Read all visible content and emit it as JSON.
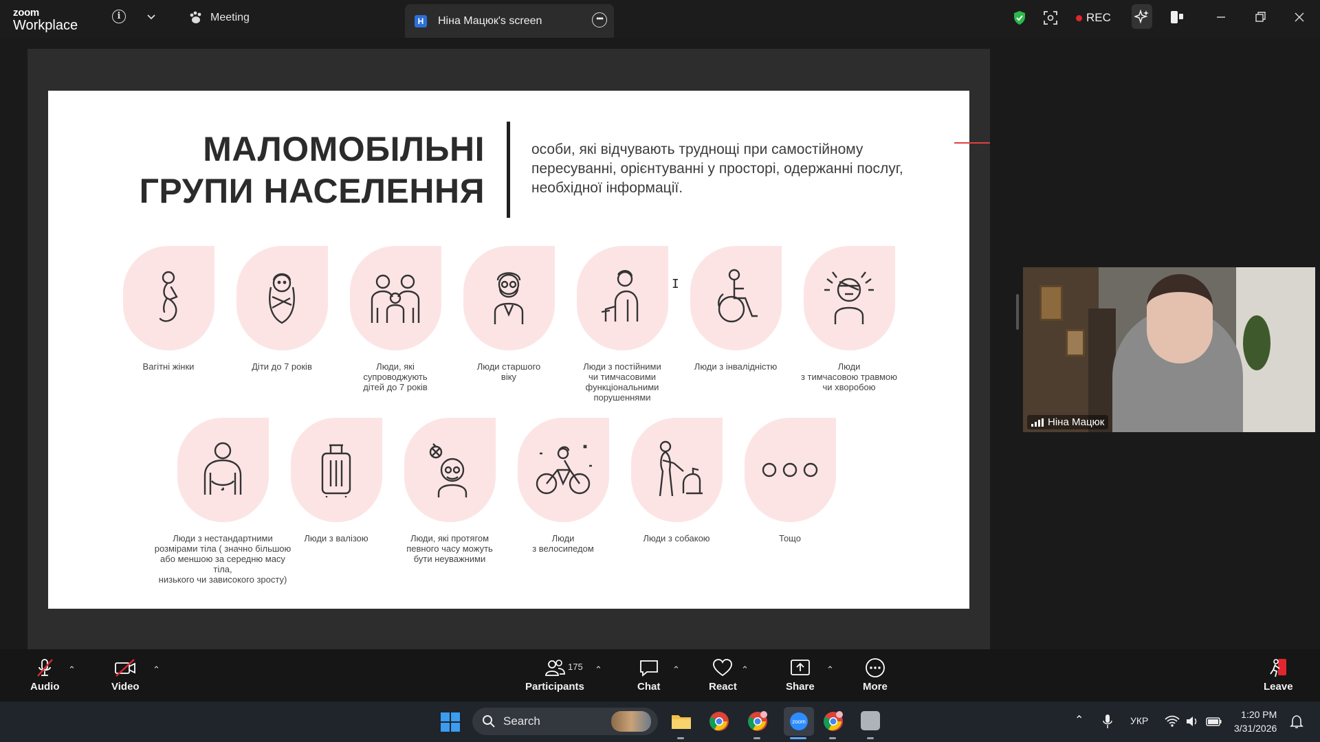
{
  "titlebar": {
    "brand_top": "zoom",
    "brand_bottom": "Workplace",
    "meeting_label": "Meeting",
    "tab_initial": "Н",
    "tab_title": "Ніна Мацюк's screen",
    "rec_label": "REC",
    "icons": [
      "info-icon",
      "chevron-down-icon",
      "paw-icon",
      "more-icon",
      "shield-icon",
      "scan-icon",
      "ai-sparkle-icon",
      "side-panel-icon",
      "minimize-icon",
      "restore-icon",
      "close-icon"
    ]
  },
  "slide": {
    "title_line1": "МАЛОМОБІЛЬНІ",
    "title_line2": "ГРУПИ НАСЕЛЕННЯ",
    "description": "особи, які відчувають труднощі при самостійному пересуванні, орієнтуванні у просторі, одержанні послуг, необхідної інформації.",
    "accent_color": "#fce4e5",
    "row1": [
      {
        "label": "Вагітні жінки",
        "icon": "pregnant-woman-icon"
      },
      {
        "label": "Діти до 7 років",
        "icon": "baby-icon"
      },
      {
        "label": "Люди, які\nсупроводжують\nдітей до 7 років",
        "icon": "family-icon"
      },
      {
        "label": "Люди старшого\nвіку",
        "icon": "elderly-man-icon"
      },
      {
        "label": "Люди з постійними\nчи тимчасовими\nфункціональними\nпорушеннями",
        "icon": "person-with-cane-icon"
      },
      {
        "label": "Люди з інвалідністю",
        "icon": "wheelchair-icon"
      },
      {
        "label": "Люди\nз тимчасовою травмою\nчи хворобою",
        "icon": "injured-person-icon"
      }
    ],
    "row2": [
      {
        "label": "Люди з нестандартними\nрозмірами тіла ( значно більшою\nабо меншою за середню масу тіла,\nнизького чи зависокого зросту)",
        "icon": "large-person-icon"
      },
      {
        "label": "Люди з валізою",
        "icon": "suitcase-icon"
      },
      {
        "label": "Люди, які протягом\nпевного часу можуть\nбути неуважними",
        "icon": "distracted-person-icon"
      },
      {
        "label": "Люди\nз велосипедом",
        "icon": "cyclist-icon"
      },
      {
        "label": "Люди з собакою",
        "icon": "person-with-dog-icon"
      },
      {
        "label": "Тощо",
        "icon": "ellipsis-icon"
      }
    ]
  },
  "video": {
    "participant_name": "Ніна Мацюк"
  },
  "controls": {
    "audio": "Audio",
    "video": "Video",
    "participants": "Participants",
    "participants_count": "175",
    "chat": "Chat",
    "react": "React",
    "share": "Share",
    "more": "More",
    "leave": "Leave"
  },
  "taskbar": {
    "search_label": "Search",
    "language": "УКР",
    "time": "1:20 PM",
    "date": "3/31/2026"
  }
}
